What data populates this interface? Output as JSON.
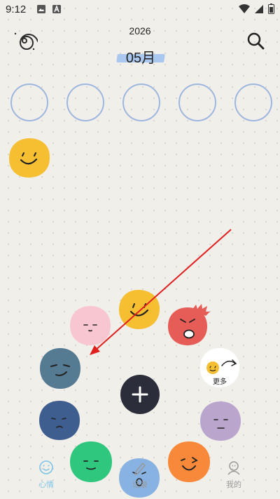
{
  "status_bar": {
    "time": "9:12"
  },
  "header": {
    "year": "2026",
    "month": "05月"
  },
  "week": {
    "days": [
      "",
      "",
      "",
      "",
      ""
    ]
  },
  "mood_picker": {
    "more_label": "更多",
    "moods": [
      "happy",
      "shy",
      "angry",
      "more",
      "cool",
      "sad",
      "neutral",
      "content",
      "cry",
      "wink"
    ]
  },
  "nav": {
    "items": [
      {
        "label": "心情",
        "active": true
      },
      {
        "label": "记录",
        "active": false
      },
      {
        "label": "我的",
        "active": false
      }
    ]
  },
  "colors": {
    "yellow": "#f6bf32",
    "pink": "#f8c6d0",
    "red": "#e65c57",
    "teal": "#557b92",
    "navy": "#3f5e90",
    "green": "#2fc77e",
    "blue": "#88b2e1",
    "orange": "#f9893a",
    "lavender": "#baa5cd",
    "accent": "#7cc4e6"
  }
}
